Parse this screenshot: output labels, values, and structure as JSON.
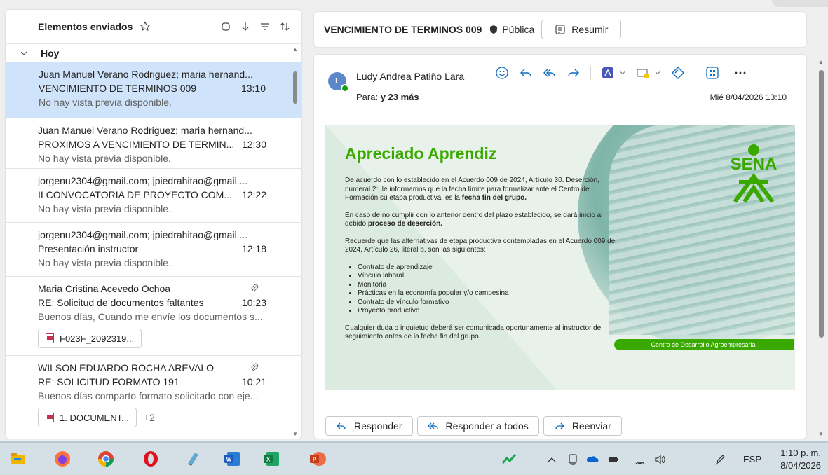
{
  "left_pane": {
    "title": "Elementos enviados",
    "group": "Hoy",
    "mails": [
      {
        "from": "Juan Manuel Verano Rodriguez; maria hernand...",
        "subject": "VENCIMIENTO DE TERMINOS 009",
        "time": "13:10",
        "preview": "No hay vista previa disponible."
      },
      {
        "from": "Juan Manuel Verano Rodriguez; maria hernand...",
        "subject": "PROXIMOS A VENCIMIENTO DE TERMIN...",
        "time": "12:30",
        "preview": "No hay vista previa disponible."
      },
      {
        "from": "jorgenu2304@gmail.com; jpiedrahitao@gmail....",
        "subject": "II CONVOCATORIA DE PROYECTO COM...",
        "time": "12:22",
        "preview": "No hay vista previa disponible."
      },
      {
        "from": "jorgenu2304@gmail.com; jpiedrahitao@gmail....",
        "subject": "Presentación instructor",
        "time": "12:18",
        "preview": "No hay vista previa disponible."
      },
      {
        "from": "Maria Cristina Acevedo Ochoa",
        "subject": "RE: Solicitud de documentos faltantes",
        "time": "10:23",
        "preview": "Buenos días, Cuando me envíe los documentos s...",
        "attachment": "F023F_2092319..."
      },
      {
        "from": "WILSON EDUARDO ROCHA AREVALO",
        "subject": "RE: SOLICITUD FORMATO 191",
        "time": "10:21",
        "preview": "Buenos días comparto formato solicitado con eje...",
        "attachment": "1. DOCUMENT...",
        "more": "+2"
      }
    ]
  },
  "subject_bar": {
    "subject": "VENCIMIENTO DE TERMINOS 009",
    "visibility": "Pública",
    "summarize": "Resumir"
  },
  "reader": {
    "avatar_letter": "L",
    "sender": "Ludy Andrea Patiño Lara",
    "to_prefix": "Para:",
    "to_rest": "y 23 más",
    "date": "Mié 8/04/2026 13:10",
    "banner": {
      "title": "Apreciado Aprendiz",
      "p1_a": "De acuerdo con lo establecido en el Acuerdo 009 de 2024, Artículo 30. Deserción, numeral 2:, le informamos que la fecha límite para formalizar ante el Centro de Formación su etapa productiva, es la ",
      "p1_b": "fecha fin del grupo.",
      "p2_a": "En caso de no cumplir con lo anterior dentro del plazo establecido, se dará inicio al debido ",
      "p2_b": "proceso de deserción.",
      "p3": "Recuerde que las alternativas de etapa productiva contempladas en el Acuerdo 009 de 2024, Artículo 26, literal b, son las siguientes:",
      "items": [
        "Contrato de aprendizaje",
        "Vínculo laboral",
        "Monitoria",
        "Prácticas en la economía popular y/o campesina",
        "Contrato de vínculo formativo",
        "Proyecto productivo"
      ],
      "p4": "Cualquier duda o inquietud deberá ser comunicada oportunamente al instructor de seguimiento antes de la fecha fin del grupo.",
      "logo": "SENA",
      "centro": "Centro de Desarrollo Agroempresarial"
    },
    "reply": "Responder",
    "reply_all": "Responder a todos",
    "forward": "Reenviar"
  },
  "taskbar": {
    "lang": "ESP",
    "time": "1:10 p. m.",
    "date": "8/04/2026"
  },
  "colors": {
    "accent": "#0f6cbd",
    "sena_green": "#39a900",
    "selection": "#cfe4fa"
  }
}
